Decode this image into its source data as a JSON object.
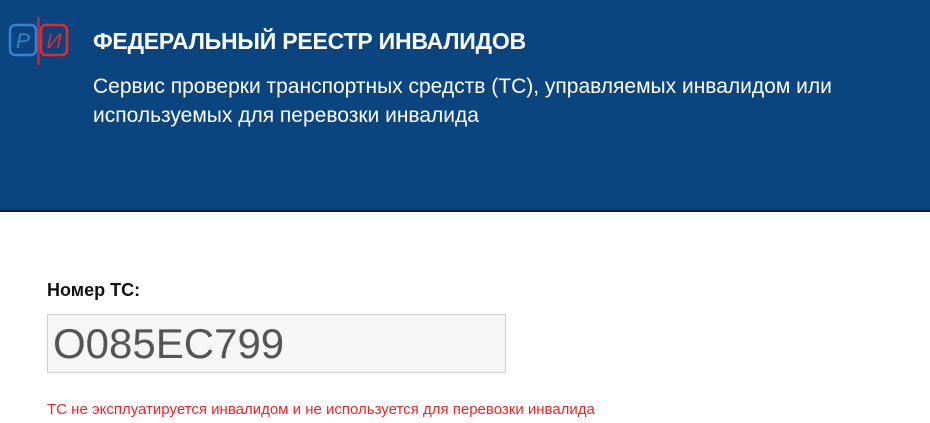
{
  "header": {
    "logo_letters": [
      "Р",
      "И"
    ],
    "title": "ФЕДЕРАЛЬНЫЙ РЕЕСТР ИНВАЛИДОВ",
    "subtitle": "Сервис проверки транспортных средств (ТС), управляемых инвалидом или используемых для перевозки инвалида"
  },
  "form": {
    "vehicle_number_label": "Номер ТС:",
    "vehicle_number_value": "О085ЕС799"
  },
  "result": {
    "message": "ТС не эксплуатируется инвалидом и не используется для перевозки инвалида"
  },
  "colors": {
    "header_bg": "#0b4580",
    "logo_blue": "#3a7fd0",
    "logo_red": "#e8262b",
    "error_text": "#e8262b"
  }
}
